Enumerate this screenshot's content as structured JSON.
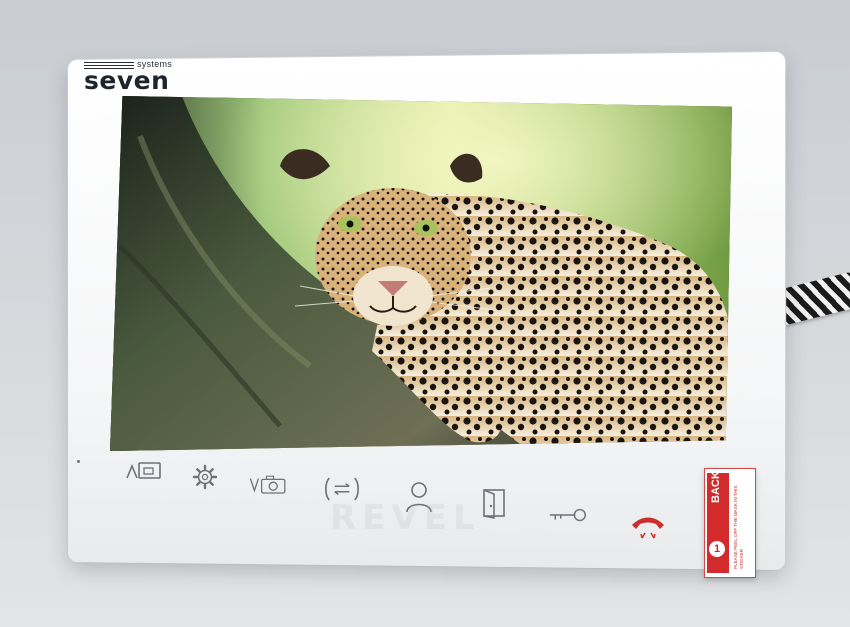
{
  "brand": {
    "name": "seven",
    "tagline": "systems"
  },
  "screen": {
    "image": "leopard-on-tree-image"
  },
  "buttons": [
    {
      "name": "monitor-button",
      "icon": "monitor-icon"
    },
    {
      "name": "settings-button",
      "icon": "gear-icon"
    },
    {
      "name": "camera-button",
      "icon": "camera-icon"
    },
    {
      "name": "transfer-button",
      "icon": "transfer-icon"
    },
    {
      "name": "user-button",
      "icon": "user-icon"
    },
    {
      "name": "door-button",
      "icon": "door-icon"
    },
    {
      "name": "key-button",
      "icon": "key-icon"
    },
    {
      "name": "hangup-button",
      "icon": "phone-hangup-icon"
    }
  ],
  "watermark": "REVEL",
  "sticker": {
    "number": "1",
    "title": "BACK",
    "text": "PLEASE PEEL OFF THE MASK IN THIS STICKER"
  },
  "colors": {
    "bezel": "#f4f5f6",
    "icon": "#6d7178",
    "hangup": "#c9302c",
    "sticker": "#d32b2b"
  }
}
